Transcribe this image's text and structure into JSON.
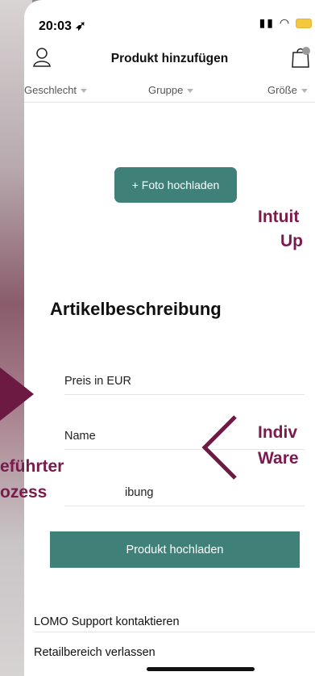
{
  "status": {
    "time": "20:03"
  },
  "header": {
    "title": "Produkt hinzufügen"
  },
  "filters": [
    "Geschlecht",
    "Gruppe",
    "Größe"
  ],
  "upload_label": "+ Foto hochladen",
  "section_title": "Artikelbeschreibung",
  "fields": [
    "Preis in EUR",
    "Name",
    "ibung"
  ],
  "submit_label": "Produkt hochladen",
  "menu": [
    "LOMO Support kontaktieren",
    "Retailbereich verlassen"
  ],
  "annotations": {
    "a1_line1": "Intuit",
    "a1_line2": "Up",
    "a2_line1": "Indiv",
    "a2_line2": "Ware",
    "a3_line1": "eführter",
    "a3_line2": "ozess"
  },
  "colors": {
    "accent": "#3f8079",
    "annotation": "#7b1a4c"
  }
}
